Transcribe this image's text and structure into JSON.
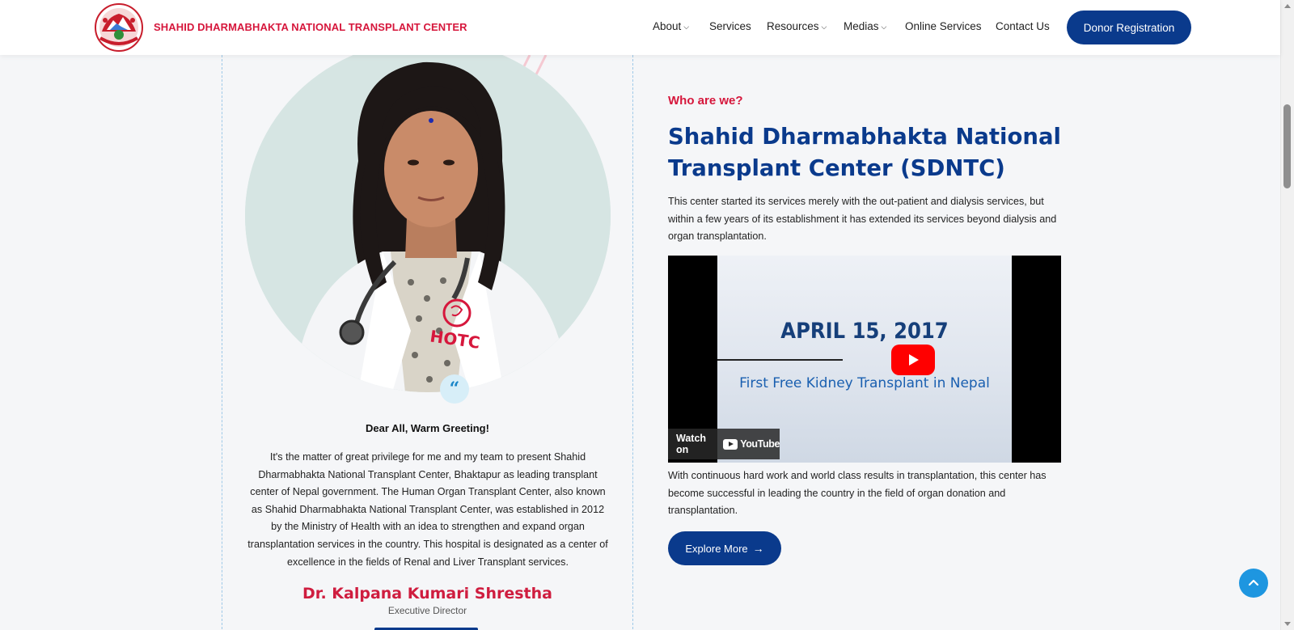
{
  "header": {
    "brand": "SHAHID DHARMABHAKTA NATIONAL TRANSPLANT CENTER",
    "nav": [
      {
        "label": "About",
        "has_dropdown": true
      },
      {
        "label": "Services",
        "has_dropdown": false
      },
      {
        "label": "Resources",
        "has_dropdown": true
      },
      {
        "label": "Medias",
        "has_dropdown": true
      },
      {
        "label": "Online Services",
        "has_dropdown": false
      },
      {
        "label": "Contact Us",
        "has_dropdown": false
      }
    ],
    "donor_button": "Donor Registration"
  },
  "director": {
    "greeting": "Dear All, Warm Greeting!",
    "message": "It's the matter of great privilege for me and my team to present Shahid Dharmabhakta National Transplant Center, Bhaktapur as leading transplant center of Nepal government. The Human Organ Transplant Center, also known as Shahid Dharmabhakta National Transplant Center, was established in 2012 by the Ministry of Health with an idea to strengthen and expand organ transplantation services in the country. This hospital is designated as a center of excellence in the fields of Renal and Liver Transplant services.",
    "name": "Dr. Kalpana Kumari Shrestha",
    "title": "Executive Director",
    "coat_text": "HOTC"
  },
  "about": {
    "eyebrow": "Who are we?",
    "headline": "Shahid Dharmabhakta National Transplant Center (SDNTC)",
    "paragraph1": "This center started its services merely with the out-patient and dialysis services, but within a few years of its establishment it has extended its services beyond dialysis and organ transplantation.",
    "paragraph2": "With continuous hard work and world class results in transplantation, this center has become successful in leading the country in the field of organ donation and transplantation.",
    "explore_button": "Explore More"
  },
  "video": {
    "date": "APRIL 15, 2017",
    "caption": "First Free Kidney Transplant in Nepal",
    "watch_on": "Watch on",
    "yt_brand": "YouTube"
  },
  "colors": {
    "brand_red": "#d6173c",
    "primary_blue": "#0a3a8c",
    "accent_blue": "#1e96e0"
  }
}
